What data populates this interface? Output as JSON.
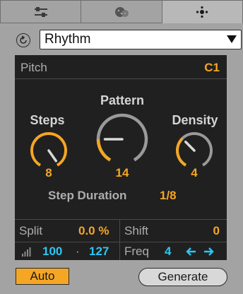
{
  "tabs": [
    {
      "icon": "sliders-icon"
    },
    {
      "icon": "dice-icon"
    },
    {
      "icon": "dots-pattern-icon",
      "active": true
    }
  ],
  "generator": {
    "selected": "Rhythm"
  },
  "pitch": {
    "label": "Pitch",
    "value": "C1"
  },
  "knobs": {
    "steps": {
      "label": "Steps",
      "value": "8",
      "level": 0.45
    },
    "pattern": {
      "label": "Pattern",
      "value": "14",
      "level": 0.2
    },
    "density": {
      "label": "Density",
      "value": "4",
      "level": 0.35
    }
  },
  "step_duration": {
    "label": "Step Duration",
    "value": "1/8"
  },
  "split": {
    "label": "Split",
    "value": "0.0 %"
  },
  "shift": {
    "label": "Shift",
    "value": "0"
  },
  "velocity": {
    "low": "100",
    "separator": "·",
    "high": "127"
  },
  "freq": {
    "label": "Freq",
    "value": "4"
  },
  "buttons": {
    "auto": "Auto",
    "generate": "Generate"
  },
  "colors": {
    "accent": "#f5a623",
    "cyan": "#2dc5f2",
    "panel": "#202020",
    "background": "#a3a3a3"
  }
}
